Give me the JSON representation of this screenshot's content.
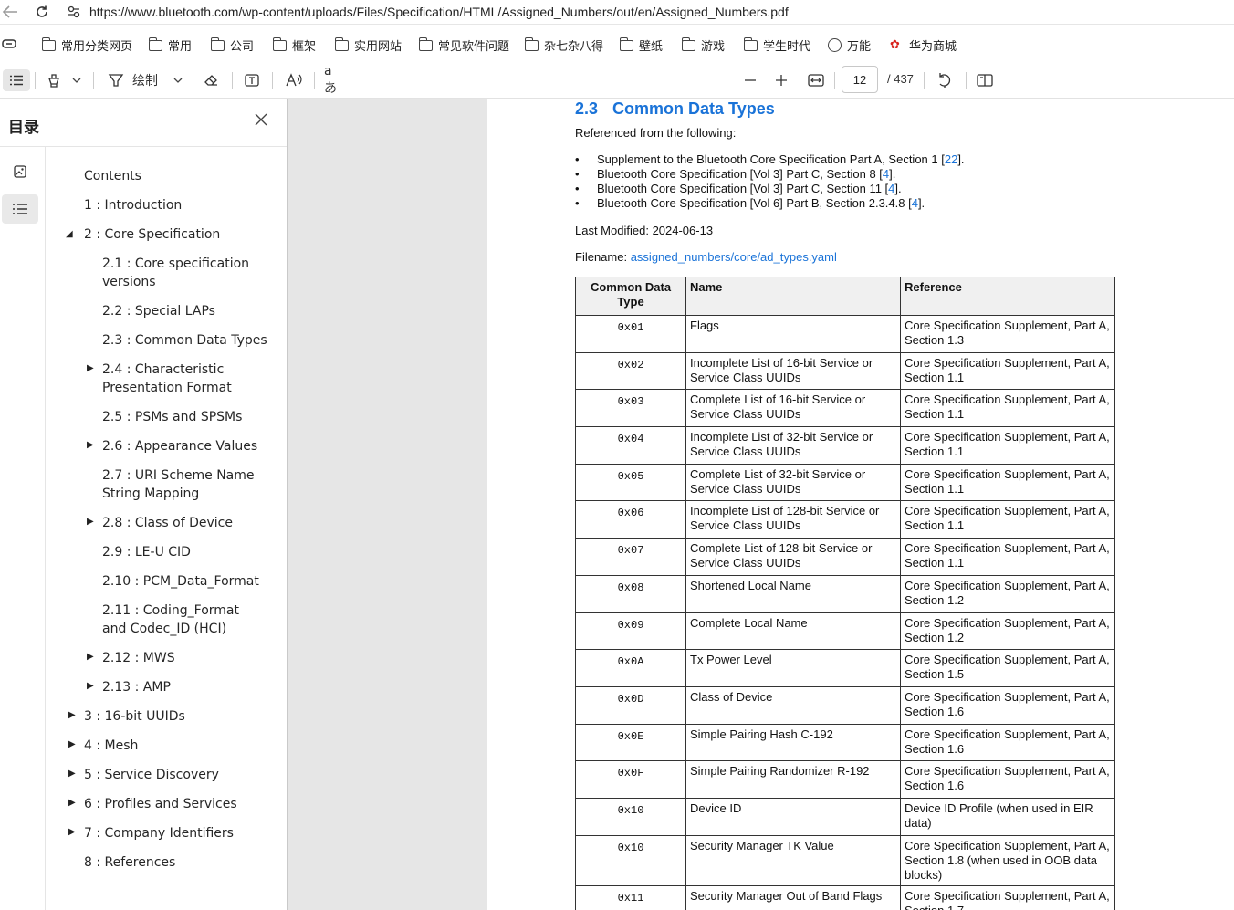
{
  "browser": {
    "url": "https://www.bluetooth.com/wp-content/uploads/Files/Specification/HTML/Assigned_Numbers/out/en/Assigned_Numbers.pdf"
  },
  "bookmarks": [
    "常用分类网页",
    "常用",
    "公司",
    "框架",
    "实用网站",
    "常见软件问题",
    "杂七杂八得",
    "壁纸",
    "游戏",
    "学生时代",
    "万能",
    "华为商城"
  ],
  "toolbar": {
    "draw_label": "绘制",
    "text_label": "aあ",
    "page_current": "12",
    "page_total": "/ 437"
  },
  "sidebar": {
    "title": "目录",
    "items": [
      {
        "label": "Contents"
      },
      {
        "label": "1 : Introduction"
      },
      {
        "label": "2 : Core Specification"
      },
      {
        "label": "2.1 : Core specification versions"
      },
      {
        "label": "2.2 : Special LAPs"
      },
      {
        "label": "2.3 : Common Data Types"
      },
      {
        "label": "2.4 : Characteristic Presentation Format"
      },
      {
        "label": "2.5 : PSMs and SPSMs"
      },
      {
        "label": "2.6 : Appearance Values"
      },
      {
        "label": "2.7 : URI Scheme Name String Mapping"
      },
      {
        "label": "2.8 : Class of Device"
      },
      {
        "label": "2.9 : LE-U CID"
      },
      {
        "label": "2.10 : PCM_Data_Format"
      },
      {
        "label": "2.11 : Coding_Format and Codec_ID (HCI)"
      },
      {
        "label": "2.12 : MWS"
      },
      {
        "label": "2.13 : AMP"
      },
      {
        "label": "3 : 16-bit UUIDs"
      },
      {
        "label": "4 : Mesh"
      },
      {
        "label": "5 : Service Discovery"
      },
      {
        "label": "6 : Profiles and Services"
      },
      {
        "label": "7 : Company Identifiers"
      },
      {
        "label": "8 : References"
      }
    ]
  },
  "doc": {
    "section_num": "2.3",
    "section_title": "Common Data Types",
    "intro": "Referenced from the following:",
    "refs": [
      {
        "text": "Supplement to the Bluetooth Core Specification Part A, Section 1 [",
        "link": "22",
        "end": "]."
      },
      {
        "text": "Bluetooth Core Specification [Vol 3] Part C, Section 8 [",
        "link": "4",
        "end": "]."
      },
      {
        "text": "Bluetooth Core Specification [Vol 3] Part C, Section 11 [",
        "link": "4",
        "end": "]."
      },
      {
        "text": "Bluetooth Core Specification [Vol 6] Part B, Section 2.3.4.8 [",
        "link": "4",
        "end": "]."
      }
    ],
    "last_modified_label": "Last Modified:",
    "last_modified": "2024-06-13",
    "filename_label": "Filename:",
    "filename": "assigned_numbers/core/ad_types.yaml",
    "table": {
      "headers": [
        "Common Data Type",
        "Name",
        "Reference"
      ],
      "rows": [
        [
          "0x01",
          "Flags",
          "Core Specification Supplement, Part A, Section 1.3"
        ],
        [
          "0x02",
          "Incomplete List of 16-bit Service or Service Class UUIDs",
          "Core Specification Supplement, Part A, Section 1.1"
        ],
        [
          "0x03",
          "Complete List of 16-bit Service or Service Class UUIDs",
          "Core Specification Supplement, Part A, Section 1.1"
        ],
        [
          "0x04",
          "Incomplete List of 32-bit Service or Service Class UUIDs",
          "Core Specification Supplement, Part A, Section 1.1"
        ],
        [
          "0x05",
          "Complete List of 32-bit Service or Service Class UUIDs",
          "Core Specification Supplement, Part A, Section 1.1"
        ],
        [
          "0x06",
          "Incomplete List of 128-bit Service or Service Class UUIDs",
          "Core Specification Supplement, Part A, Section 1.1"
        ],
        [
          "0x07",
          "Complete List of 128-bit Service or Service Class UUIDs",
          "Core Specification Supplement, Part A, Section 1.1"
        ],
        [
          "0x08",
          "Shortened Local Name",
          "Core Specification Supplement, Part A, Section 1.2"
        ],
        [
          "0x09",
          "Complete Local Name",
          "Core Specification Supplement, Part A, Section 1.2"
        ],
        [
          "0x0A",
          "Tx Power Level",
          "Core Specification Supplement, Part A, Section 1.5"
        ],
        [
          "0x0D",
          "Class of Device",
          "Core Specification Supplement, Part A, Section 1.6"
        ],
        [
          "0x0E",
          "Simple Pairing Hash C-192",
          "Core Specification Supplement, Part A, Section 1.6"
        ],
        [
          "0x0F",
          "Simple Pairing Randomizer R-192",
          "Core Specification Supplement, Part A, Section 1.6"
        ],
        [
          "0x10",
          "Device ID",
          "Device ID Profile (when used in EIR data)"
        ],
        [
          "0x10",
          "Security Manager TK Value",
          "Core Specification Supplement, Part A, Section 1.8 (when used in OOB data blocks)"
        ],
        [
          "0x11",
          "Security Manager Out of Band Flags",
          "Core Specification Supplement, Part A, Section 1.7"
        ]
      ]
    }
  }
}
